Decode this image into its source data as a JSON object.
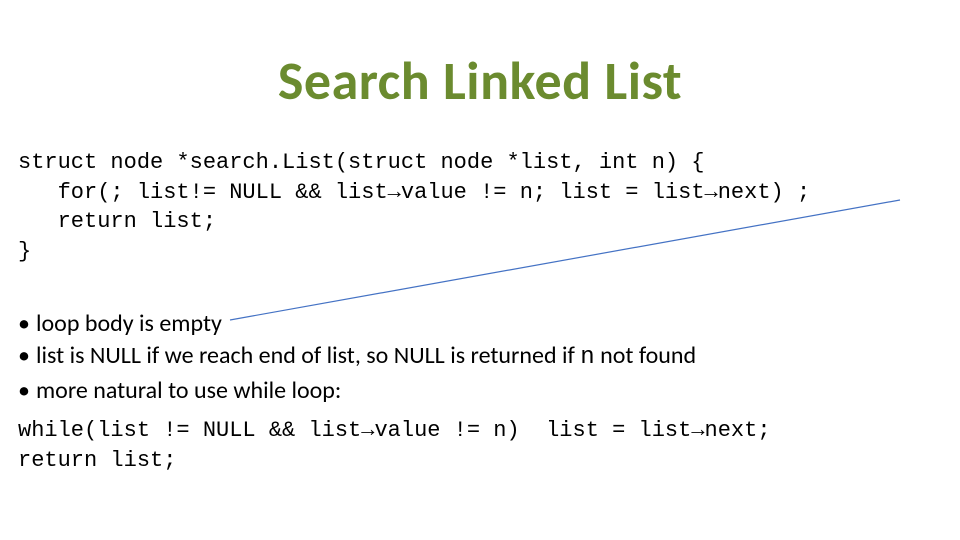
{
  "title": "Search Linked List",
  "code": {
    "line1_a": "struct node *search.List(struct node *list, int n) {",
    "line2_a": "   for(; list!= NULL && list",
    "line2_b": "value != n; list = list",
    "line2_c": "next) ;",
    "line3": "   return list;",
    "line4": "}"
  },
  "bullets": {
    "b1": "loop body is empty",
    "b2_a": "list is NULL if we reach end of list, so NULL is returned if ",
    "b2_b": "n",
    "b2_c": " not found",
    "b3": "more natural to use while loop:"
  },
  "code2": {
    "line1_a": "while(list != NULL && list",
    "line1_b": "value != n)  list = list",
    "line1_c": "next;",
    "line2": "return list;"
  },
  "glyphs": {
    "arrow": "→",
    "bullet": "•"
  }
}
